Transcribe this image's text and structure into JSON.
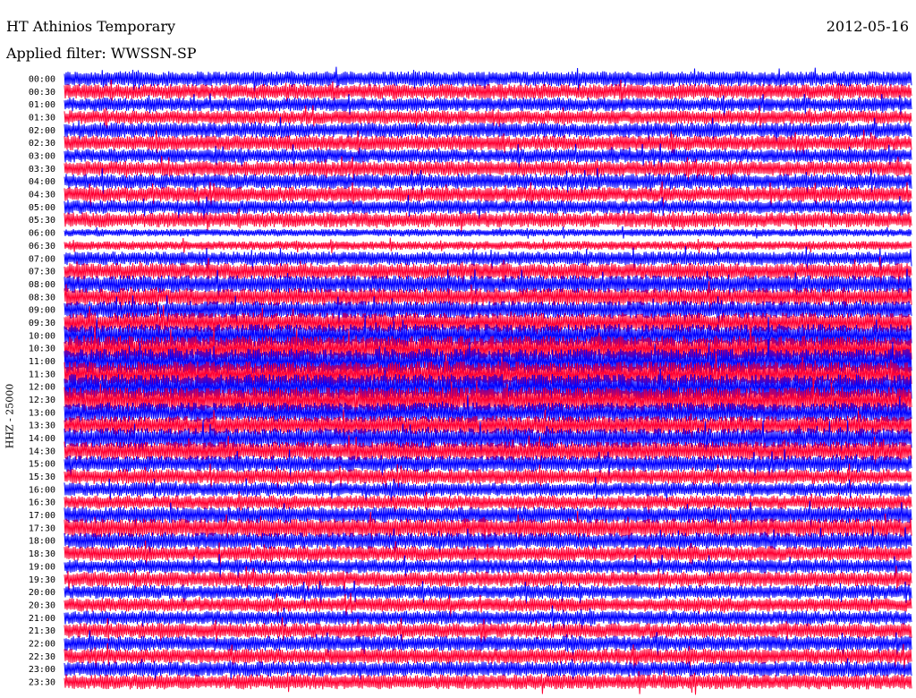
{
  "header": {
    "station": "HT Athinios Temporary",
    "date": "2012-05-16",
    "filter": "Applied filter: WWSSN-SP"
  },
  "chart_data": {
    "type": "line",
    "title": "HT Athinios Temporary",
    "ylabel": "HHZ - 25000",
    "xlabel": "",
    "colors": {
      "odd_rows": "#0000ff",
      "even_rows": "#ff0033"
    },
    "row_labels": [
      "00:00",
      "00:30",
      "01:00",
      "01:30",
      "02:00",
      "02:30",
      "03:00",
      "03:30",
      "04:00",
      "04:30",
      "05:00",
      "05:30",
      "06:00",
      "06:30",
      "07:00",
      "07:30",
      "08:00",
      "08:30",
      "09:00",
      "09:30",
      "10:00",
      "10:30",
      "11:00",
      "11:30",
      "12:00",
      "12:30",
      "13:00",
      "13:30",
      "14:00",
      "14:30",
      "15:00",
      "15:30",
      "16:00",
      "16:30",
      "17:00",
      "17:30",
      "18:00",
      "18:30",
      "19:00",
      "19:30",
      "20:00",
      "20:30",
      "21:00",
      "21:30",
      "22:00",
      "22:30",
      "23:00",
      "23:30"
    ],
    "row_amplitude": [
      0.6,
      0.6,
      0.55,
      0.55,
      0.6,
      0.6,
      0.55,
      0.6,
      0.6,
      0.6,
      0.55,
      0.6,
      0.3,
      0.35,
      0.55,
      0.65,
      0.7,
      0.7,
      0.7,
      0.8,
      0.9,
      1.0,
      1.0,
      1.0,
      1.0,
      1.0,
      0.8,
      0.75,
      0.8,
      0.75,
      0.65,
      0.6,
      0.55,
      0.55,
      0.65,
      0.75,
      0.65,
      0.6,
      0.55,
      0.6,
      0.55,
      0.55,
      0.55,
      0.6,
      0.6,
      0.6,
      0.6,
      0.6
    ]
  }
}
